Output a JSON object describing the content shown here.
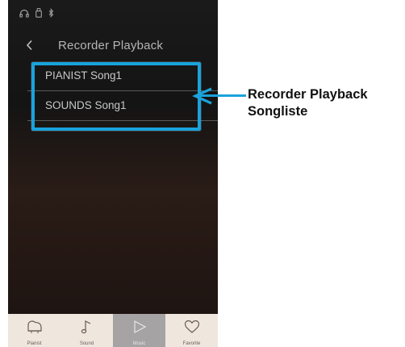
{
  "header": {
    "title": "Recorder Playback"
  },
  "song_list": [
    {
      "label": "PIANIST Song1"
    },
    {
      "label": "SOUNDS Song1"
    }
  ],
  "bottom_nav": [
    {
      "label": "Pianist",
      "icon": "piano-icon",
      "active": false
    },
    {
      "label": "Sound",
      "icon": "music-note-icon",
      "active": false
    },
    {
      "label": "Music",
      "icon": "play-icon",
      "active": true
    },
    {
      "label": "Favorite",
      "icon": "heart-icon",
      "active": false
    }
  ],
  "callout": {
    "line1": "Recorder Playback",
    "line2": "Songliste",
    "color": "#1aa3dc"
  },
  "colors": {
    "accent": "#1aa3dc",
    "nav_background": "#efe6dd",
    "nav_active": "#a5a3a3"
  }
}
